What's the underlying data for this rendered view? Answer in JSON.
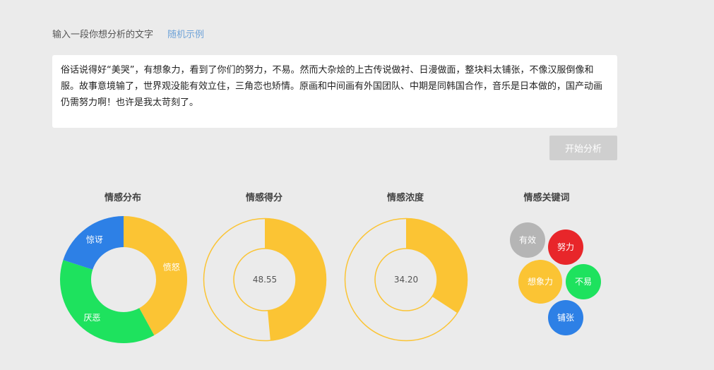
{
  "input": {
    "prompt_label": "输入一段你想分析的文字",
    "random_example_link": "随机示例",
    "text": "俗话说得好“美哭”，有想象力，看到了你们的努力，不易。然而大杂烩的上古传说做衬、日漫做面，整块料太铺张，不像汉服倒像和服。故事意境输了，世界观没能有效立住，三角恋也矫情。原画和中间画有外国团队、中期是同韩国合作，音乐是日本做的，国产动画仍需努力啊！也许是我太苛刻了。"
  },
  "analyze_button": "开始分析",
  "colors": {
    "yellow": "#fbc434",
    "green": "#1ee25e",
    "blue": "#2d80e6",
    "red": "#e8262a",
    "gray": "#b5b5b5"
  },
  "panels": {
    "distribution_title": "情感分布",
    "score_title": "情感得分",
    "intensity_title": "情感浓度",
    "keywords_title": "情感关键词"
  },
  "chart_data": [
    {
      "type": "pie",
      "title": "情感分布",
      "categories": [
        "愤怒",
        "厌恶",
        "惊讶"
      ],
      "values": [
        42,
        38,
        20
      ],
      "colors": [
        "#fbc434",
        "#1ee25e",
        "#2d80e6"
      ]
    },
    {
      "type": "pie",
      "title": "情感得分",
      "value": 48.55,
      "max": 100,
      "label": "48.55"
    },
    {
      "type": "pie",
      "title": "情感浓度",
      "value": 34.2,
      "max": 100,
      "label": "34.20"
    }
  ],
  "keywords": [
    {
      "word": "有效",
      "color": "gray"
    },
    {
      "word": "努力",
      "color": "red"
    },
    {
      "word": "想象力",
      "color": "yellow"
    },
    {
      "word": "不易",
      "color": "green"
    },
    {
      "word": "铺张",
      "color": "blue"
    }
  ]
}
